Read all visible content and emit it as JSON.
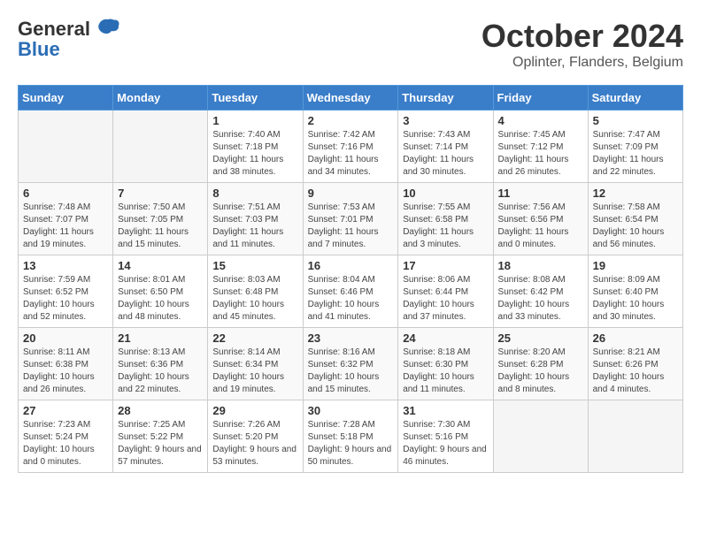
{
  "header": {
    "logo_general": "General",
    "logo_blue": "Blue",
    "month_title": "October 2024",
    "location": "Oplinter, Flanders, Belgium"
  },
  "weekdays": [
    "Sunday",
    "Monday",
    "Tuesday",
    "Wednesday",
    "Thursday",
    "Friday",
    "Saturday"
  ],
  "weeks": [
    [
      {
        "day": "",
        "sunrise": "",
        "sunset": "",
        "daylight": ""
      },
      {
        "day": "",
        "sunrise": "",
        "sunset": "",
        "daylight": ""
      },
      {
        "day": "1",
        "sunrise": "Sunrise: 7:40 AM",
        "sunset": "Sunset: 7:18 PM",
        "daylight": "Daylight: 11 hours and 38 minutes."
      },
      {
        "day": "2",
        "sunrise": "Sunrise: 7:42 AM",
        "sunset": "Sunset: 7:16 PM",
        "daylight": "Daylight: 11 hours and 34 minutes."
      },
      {
        "day": "3",
        "sunrise": "Sunrise: 7:43 AM",
        "sunset": "Sunset: 7:14 PM",
        "daylight": "Daylight: 11 hours and 30 minutes."
      },
      {
        "day": "4",
        "sunrise": "Sunrise: 7:45 AM",
        "sunset": "Sunset: 7:12 PM",
        "daylight": "Daylight: 11 hours and 26 minutes."
      },
      {
        "day": "5",
        "sunrise": "Sunrise: 7:47 AM",
        "sunset": "Sunset: 7:09 PM",
        "daylight": "Daylight: 11 hours and 22 minutes."
      }
    ],
    [
      {
        "day": "6",
        "sunrise": "Sunrise: 7:48 AM",
        "sunset": "Sunset: 7:07 PM",
        "daylight": "Daylight: 11 hours and 19 minutes."
      },
      {
        "day": "7",
        "sunrise": "Sunrise: 7:50 AM",
        "sunset": "Sunset: 7:05 PM",
        "daylight": "Daylight: 11 hours and 15 minutes."
      },
      {
        "day": "8",
        "sunrise": "Sunrise: 7:51 AM",
        "sunset": "Sunset: 7:03 PM",
        "daylight": "Daylight: 11 hours and 11 minutes."
      },
      {
        "day": "9",
        "sunrise": "Sunrise: 7:53 AM",
        "sunset": "Sunset: 7:01 PM",
        "daylight": "Daylight: 11 hours and 7 minutes."
      },
      {
        "day": "10",
        "sunrise": "Sunrise: 7:55 AM",
        "sunset": "Sunset: 6:58 PM",
        "daylight": "Daylight: 11 hours and 3 minutes."
      },
      {
        "day": "11",
        "sunrise": "Sunrise: 7:56 AM",
        "sunset": "Sunset: 6:56 PM",
        "daylight": "Daylight: 11 hours and 0 minutes."
      },
      {
        "day": "12",
        "sunrise": "Sunrise: 7:58 AM",
        "sunset": "Sunset: 6:54 PM",
        "daylight": "Daylight: 10 hours and 56 minutes."
      }
    ],
    [
      {
        "day": "13",
        "sunrise": "Sunrise: 7:59 AM",
        "sunset": "Sunset: 6:52 PM",
        "daylight": "Daylight: 10 hours and 52 minutes."
      },
      {
        "day": "14",
        "sunrise": "Sunrise: 8:01 AM",
        "sunset": "Sunset: 6:50 PM",
        "daylight": "Daylight: 10 hours and 48 minutes."
      },
      {
        "day": "15",
        "sunrise": "Sunrise: 8:03 AM",
        "sunset": "Sunset: 6:48 PM",
        "daylight": "Daylight: 10 hours and 45 minutes."
      },
      {
        "day": "16",
        "sunrise": "Sunrise: 8:04 AM",
        "sunset": "Sunset: 6:46 PM",
        "daylight": "Daylight: 10 hours and 41 minutes."
      },
      {
        "day": "17",
        "sunrise": "Sunrise: 8:06 AM",
        "sunset": "Sunset: 6:44 PM",
        "daylight": "Daylight: 10 hours and 37 minutes."
      },
      {
        "day": "18",
        "sunrise": "Sunrise: 8:08 AM",
        "sunset": "Sunset: 6:42 PM",
        "daylight": "Daylight: 10 hours and 33 minutes."
      },
      {
        "day": "19",
        "sunrise": "Sunrise: 8:09 AM",
        "sunset": "Sunset: 6:40 PM",
        "daylight": "Daylight: 10 hours and 30 minutes."
      }
    ],
    [
      {
        "day": "20",
        "sunrise": "Sunrise: 8:11 AM",
        "sunset": "Sunset: 6:38 PM",
        "daylight": "Daylight: 10 hours and 26 minutes."
      },
      {
        "day": "21",
        "sunrise": "Sunrise: 8:13 AM",
        "sunset": "Sunset: 6:36 PM",
        "daylight": "Daylight: 10 hours and 22 minutes."
      },
      {
        "day": "22",
        "sunrise": "Sunrise: 8:14 AM",
        "sunset": "Sunset: 6:34 PM",
        "daylight": "Daylight: 10 hours and 19 minutes."
      },
      {
        "day": "23",
        "sunrise": "Sunrise: 8:16 AM",
        "sunset": "Sunset: 6:32 PM",
        "daylight": "Daylight: 10 hours and 15 minutes."
      },
      {
        "day": "24",
        "sunrise": "Sunrise: 8:18 AM",
        "sunset": "Sunset: 6:30 PM",
        "daylight": "Daylight: 10 hours and 11 minutes."
      },
      {
        "day": "25",
        "sunrise": "Sunrise: 8:20 AM",
        "sunset": "Sunset: 6:28 PM",
        "daylight": "Daylight: 10 hours and 8 minutes."
      },
      {
        "day": "26",
        "sunrise": "Sunrise: 8:21 AM",
        "sunset": "Sunset: 6:26 PM",
        "daylight": "Daylight: 10 hours and 4 minutes."
      }
    ],
    [
      {
        "day": "27",
        "sunrise": "Sunrise: 7:23 AM",
        "sunset": "Sunset: 5:24 PM",
        "daylight": "Daylight: 10 hours and 0 minutes."
      },
      {
        "day": "28",
        "sunrise": "Sunrise: 7:25 AM",
        "sunset": "Sunset: 5:22 PM",
        "daylight": "Daylight: 9 hours and 57 minutes."
      },
      {
        "day": "29",
        "sunrise": "Sunrise: 7:26 AM",
        "sunset": "Sunset: 5:20 PM",
        "daylight": "Daylight: 9 hours and 53 minutes."
      },
      {
        "day": "30",
        "sunrise": "Sunrise: 7:28 AM",
        "sunset": "Sunset: 5:18 PM",
        "daylight": "Daylight: 9 hours and 50 minutes."
      },
      {
        "day": "31",
        "sunrise": "Sunrise: 7:30 AM",
        "sunset": "Sunset: 5:16 PM",
        "daylight": "Daylight: 9 hours and 46 minutes."
      },
      {
        "day": "",
        "sunrise": "",
        "sunset": "",
        "daylight": ""
      },
      {
        "day": "",
        "sunrise": "",
        "sunset": "",
        "daylight": ""
      }
    ]
  ]
}
